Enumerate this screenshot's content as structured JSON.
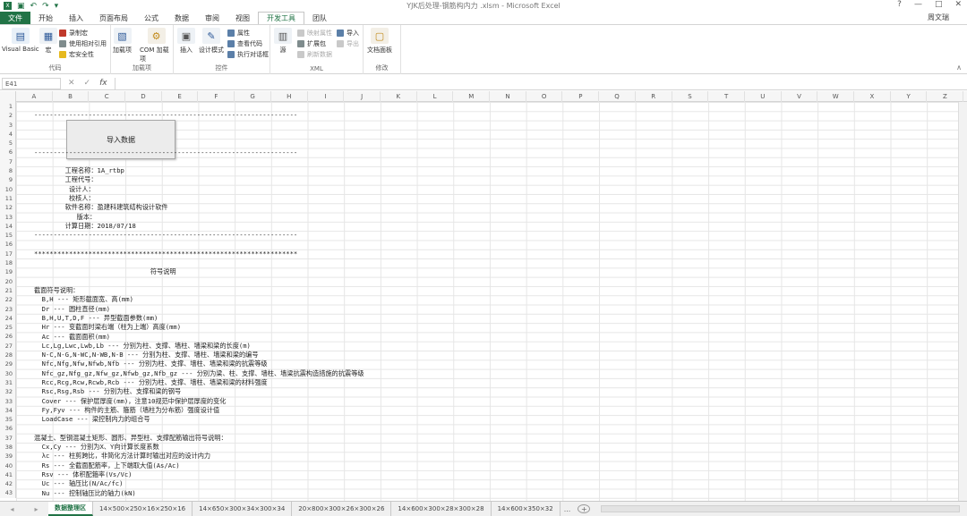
{
  "window": {
    "title": "YJK后处理-钢筋构内力 .xlsm - Microsoft Excel",
    "user": "周文瑞",
    "help": "?",
    "controls": [
      "?",
      "—",
      "□",
      "✕"
    ]
  },
  "tabs": [
    {
      "label": "文件",
      "kind": "file"
    },
    {
      "label": "开始"
    },
    {
      "label": "插入"
    },
    {
      "label": "页面布局"
    },
    {
      "label": "公式"
    },
    {
      "label": "数据"
    },
    {
      "label": "审阅"
    },
    {
      "label": "视图"
    },
    {
      "label": "开发工具",
      "kind": "active"
    },
    {
      "label": "团队"
    }
  ],
  "ribbon": {
    "code": {
      "label": "代码",
      "visual_basic": "Visual Basic",
      "macro": "宏",
      "record_macro": "录制宏",
      "relative_ref": "使用相对引用",
      "macro_security": "宏安全性"
    },
    "addins": {
      "label": "加载项",
      "addins_btn": "加载项",
      "com_addins": "COM 加载项"
    },
    "controls": {
      "label": "控件",
      "insert": "插入",
      "design_mode": "设计模式",
      "properties": "属性",
      "view_code": "查看代码",
      "run_dialog": "执行对话框"
    },
    "xml": {
      "label": "XML",
      "source": "源",
      "map_props": "映射属性",
      "expansion": "扩展包",
      "refresh": "刷新数据",
      "import": "导入",
      "export": "导出"
    },
    "modify": {
      "label": "修改",
      "doc_panel": "文档面板"
    }
  },
  "formula_bar": {
    "name_box": "E41",
    "cancel": "✕",
    "enter": "✓",
    "fx": "fx"
  },
  "columns": [
    "A",
    "B",
    "C",
    "D",
    "E",
    "F",
    "G",
    "H",
    "I",
    "J",
    "K",
    "L",
    "M",
    "N",
    "O",
    "P",
    "Q",
    "R",
    "S",
    "T",
    "U",
    "V",
    "W",
    "X",
    "Y",
    "Z"
  ],
  "rows": [
    "1",
    "2",
    "3",
    "4",
    "5",
    "6",
    "7",
    "8",
    "9",
    "10",
    "11",
    "12",
    "13",
    "14",
    "15",
    "16",
    "17",
    "18",
    "19",
    "20",
    "21",
    "22",
    "23",
    "24",
    "25",
    "26",
    "27",
    "28",
    "29",
    "30",
    "31",
    "32",
    "33",
    "34",
    "35",
    "36",
    "37",
    "38",
    "39",
    "40",
    "41",
    "42",
    "43"
  ],
  "import_button": "导入数据",
  "sheet_lines": [
    {
      "row": 2,
      "text": "--------------------------------------------------------------------"
    },
    {
      "row": 6,
      "text": "--------------------------------------------------------------------"
    },
    {
      "row": 8,
      "text": "        工程名称：1A_rtbp"
    },
    {
      "row": 9,
      "text": "        工程代号："
    },
    {
      "row": 10,
      "text": "         设计人："
    },
    {
      "row": 11,
      "text": "         校核人："
    },
    {
      "row": 12,
      "text": "        软件名称：盈建科建筑结构设计软件"
    },
    {
      "row": 13,
      "text": "           版本："
    },
    {
      "row": 14,
      "text": "        计算日期：2018/07/18"
    },
    {
      "row": 15,
      "text": "--------------------------------------------------------------------"
    },
    {
      "row": 17,
      "text": "********************************************************************"
    },
    {
      "row": 19,
      "text": "                              符号说明"
    },
    {
      "row": 21,
      "text": "截面符号说明："
    },
    {
      "row": 22,
      "text": "  B,H --- 矩形截面宽、高(mm)"
    },
    {
      "row": 23,
      "text": "  Dr --- 圆柱直径(mm)"
    },
    {
      "row": 24,
      "text": "  B,H,U,T,D,F --- 异型截面参数(mm)"
    },
    {
      "row": 25,
      "text": "  Hr --- 变截面时梁右端（柱为上端）高度(mm)"
    },
    {
      "row": 26,
      "text": "  Ac --- 截面面积(mm)"
    },
    {
      "row": 27,
      "text": "  Lc,Lg,Lwc,Lwb,Lb --- 分别为柱、支撑、墙柱、墙梁和梁的长度(m)"
    },
    {
      "row": 28,
      "text": "  N-C,N-G,N-WC,N-WB,N-B --- 分别为柱、支撑、墙柱、墙梁和梁的编号"
    },
    {
      "row": 29,
      "text": "  Nfc,Nfg,Nfw,Nfwb,Nfb --- 分别为柱、支撑、墙柱、墙梁和梁的抗震等级"
    },
    {
      "row": 30,
      "text": "  Nfc_gz,Nfg_gz,Nfw_gz,Nfwb_gz,Nfb_gz --- 分别为梁、柱、支撑、墙柱、墙梁抗震构造措施的抗震等级"
    },
    {
      "row": 31,
      "text": "  Rcc,Rcg,Rcw,Rcwb,Rcb --- 分别为柱、支撑、墙柱、墙梁和梁的材料强度"
    },
    {
      "row": 32,
      "text": "  Rsc,Rsg,Rsb --- 分别为柱、支撑和梁的钢号"
    },
    {
      "row": 33,
      "text": "  Cover --- 保护层厚度(mm)，注意10规范中保护层厚度的变化"
    },
    {
      "row": 34,
      "text": "  Fy,Fyv --- 构件的主筋、箍筋（墙柱为分布筋）强度设计值"
    },
    {
      "row": 35,
      "text": "  LoadCase --- 梁控制内力的组合号"
    },
    {
      "row": 37,
      "text": "混凝土、型钢混凝土矩形、圆形、异型柱、支撑配筋输出符号说明："
    },
    {
      "row": 38,
      "text": "  Cx,Cy --- 分别为X、Y向计算长度系数"
    },
    {
      "row": 39,
      "text": "  λc --- 柱剪跨比，非简化方法计算时输出对应的设计内力"
    },
    {
      "row": 40,
      "text": "  Rs --- 全截面配筋率，上下端取大值(As/Ac)"
    },
    {
      "row": 41,
      "text": "  Rsv --- 体积配箍率(Vs/Vc)"
    },
    {
      "row": 42,
      "text": "  Uc --- 轴压比(N/Ac/fc)"
    },
    {
      "row": 43,
      "text": "  Nu --- 控制轴压比的轴力(kN)"
    }
  ],
  "sheet_tabs": [
    {
      "label": "数据整理区",
      "active": true
    },
    {
      "label": "14×500×250×16×250×16"
    },
    {
      "label": "14×650×300×34×300×34"
    },
    {
      "label": "20×800×300×26×300×26"
    },
    {
      "label": "14×600×300×28×300×28"
    },
    {
      "label": "14×600×350×32"
    }
  ],
  "sheet_more": "...",
  "add_sheet": "+",
  "colors": {
    "accent": "#217346"
  }
}
